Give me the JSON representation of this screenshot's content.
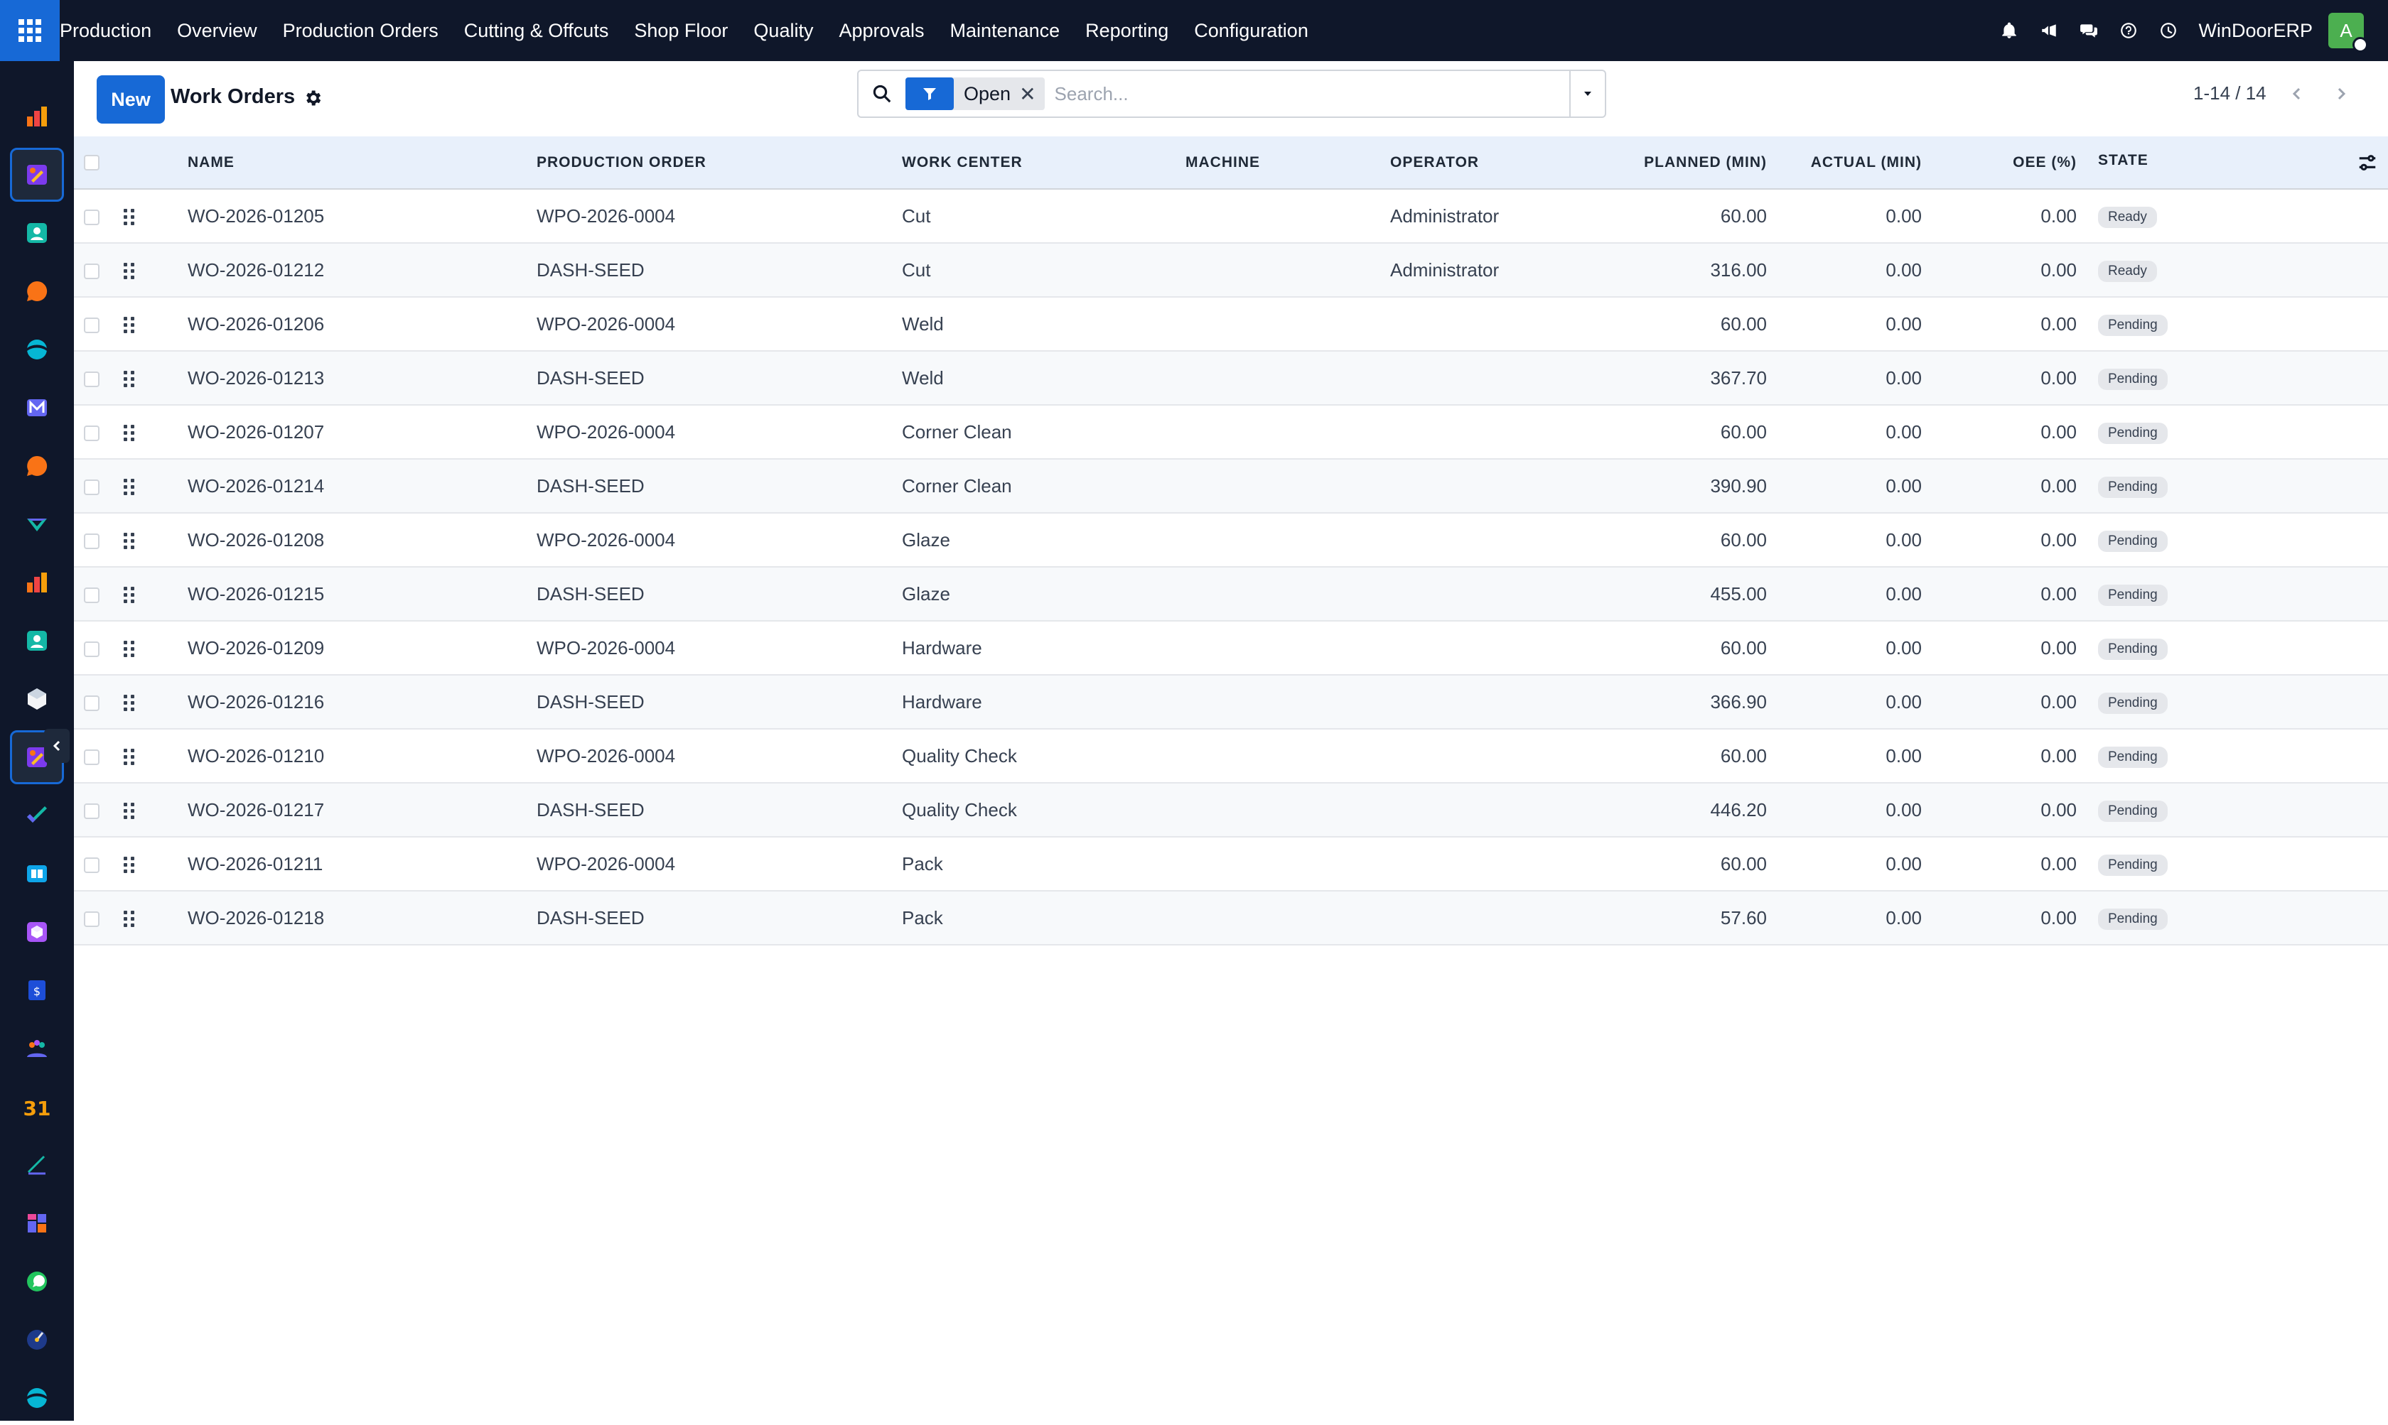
{
  "app": {
    "brand": "Production",
    "company": "WinDoorERP",
    "avatar_letter": "A",
    "colors": {
      "navbar": "#0f172a",
      "primary": "#1769d6",
      "header_row": "#e8f0fb"
    }
  },
  "navbar": {
    "menu": [
      "Overview",
      "Production Orders",
      "Cutting & Offcuts",
      "Shop Floor",
      "Quality",
      "Approvals",
      "Maintenance",
      "Reporting",
      "Configuration"
    ],
    "icons": [
      "bell-icon",
      "megaphone-icon",
      "chat-icon",
      "help-icon",
      "clock-icon"
    ]
  },
  "sidebar": {
    "apps": [
      "bar-chart-app-icon",
      "manufacturing-app-icon",
      "contacts-app-icon",
      "discuss-app-icon",
      "planning-app-icon",
      "mail-app-icon",
      "livechat-app-icon",
      "project-app-icon",
      "inventory-app-icon",
      "employees-app-icon",
      "shop-floor-app-icon",
      "approvals-app-icon",
      "knowledge-app-icon",
      "apps-store-icon",
      "expenses-app-icon",
      "team-app-icon",
      "calendar-app-icon",
      "sign-app-icon",
      "dashboards-app-icon",
      "whatsapp-app-icon",
      "timesheets-app-icon",
      "website-app-icon"
    ]
  },
  "control": {
    "new_label": "New",
    "title": "Work Orders",
    "filter_label": "Open",
    "search_placeholder": "Search...",
    "pager": "1-14 / 14"
  },
  "table": {
    "columns": {
      "name": "Name",
      "production_order": "Production Order",
      "work_center": "Work Center",
      "machine": "Machine",
      "operator": "Operator",
      "planned": "Planned (min)",
      "actual": "Actual (min)",
      "oee": "OEE (%)",
      "state": "State"
    },
    "rows": [
      {
        "name": "WO-2026-01205",
        "production_order": "WPO-2026-0004",
        "work_center": "Cut",
        "machine": "",
        "operator": "Administrator",
        "planned": "60.00",
        "actual": "0.00",
        "oee": "0.00",
        "state": "Ready"
      },
      {
        "name": "WO-2026-01212",
        "production_order": "DASH-SEED",
        "work_center": "Cut",
        "machine": "",
        "operator": "Administrator",
        "planned": "316.00",
        "actual": "0.00",
        "oee": "0.00",
        "state": "Ready"
      },
      {
        "name": "WO-2026-01206",
        "production_order": "WPO-2026-0004",
        "work_center": "Weld",
        "machine": "",
        "operator": "",
        "planned": "60.00",
        "actual": "0.00",
        "oee": "0.00",
        "state": "Pending"
      },
      {
        "name": "WO-2026-01213",
        "production_order": "DASH-SEED",
        "work_center": "Weld",
        "machine": "",
        "operator": "",
        "planned": "367.70",
        "actual": "0.00",
        "oee": "0.00",
        "state": "Pending"
      },
      {
        "name": "WO-2026-01207",
        "production_order": "WPO-2026-0004",
        "work_center": "Corner Clean",
        "machine": "",
        "operator": "",
        "planned": "60.00",
        "actual": "0.00",
        "oee": "0.00",
        "state": "Pending"
      },
      {
        "name": "WO-2026-01214",
        "production_order": "DASH-SEED",
        "work_center": "Corner Clean",
        "machine": "",
        "operator": "",
        "planned": "390.90",
        "actual": "0.00",
        "oee": "0.00",
        "state": "Pending"
      },
      {
        "name": "WO-2026-01208",
        "production_order": "WPO-2026-0004",
        "work_center": "Glaze",
        "machine": "",
        "operator": "",
        "planned": "60.00",
        "actual": "0.00",
        "oee": "0.00",
        "state": "Pending"
      },
      {
        "name": "WO-2026-01215",
        "production_order": "DASH-SEED",
        "work_center": "Glaze",
        "machine": "",
        "operator": "",
        "planned": "455.00",
        "actual": "0.00",
        "oee": "0.00",
        "state": "Pending"
      },
      {
        "name": "WO-2026-01209",
        "production_order": "WPO-2026-0004",
        "work_center": "Hardware",
        "machine": "",
        "operator": "",
        "planned": "60.00",
        "actual": "0.00",
        "oee": "0.00",
        "state": "Pending"
      },
      {
        "name": "WO-2026-01216",
        "production_order": "DASH-SEED",
        "work_center": "Hardware",
        "machine": "",
        "operator": "",
        "planned": "366.90",
        "actual": "0.00",
        "oee": "0.00",
        "state": "Pending"
      },
      {
        "name": "WO-2026-01210",
        "production_order": "WPO-2026-0004",
        "work_center": "Quality Check",
        "machine": "",
        "operator": "",
        "planned": "60.00",
        "actual": "0.00",
        "oee": "0.00",
        "state": "Pending"
      },
      {
        "name": "WO-2026-01217",
        "production_order": "DASH-SEED",
        "work_center": "Quality Check",
        "machine": "",
        "operator": "",
        "planned": "446.20",
        "actual": "0.00",
        "oee": "0.00",
        "state": "Pending"
      },
      {
        "name": "WO-2026-01211",
        "production_order": "WPO-2026-0004",
        "work_center": "Pack",
        "machine": "",
        "operator": "",
        "planned": "60.00",
        "actual": "0.00",
        "oee": "0.00",
        "state": "Pending"
      },
      {
        "name": "WO-2026-01218",
        "production_order": "DASH-SEED",
        "work_center": "Pack",
        "machine": "",
        "operator": "",
        "planned": "57.60",
        "actual": "0.00",
        "oee": "0.00",
        "state": "Pending"
      }
    ]
  }
}
